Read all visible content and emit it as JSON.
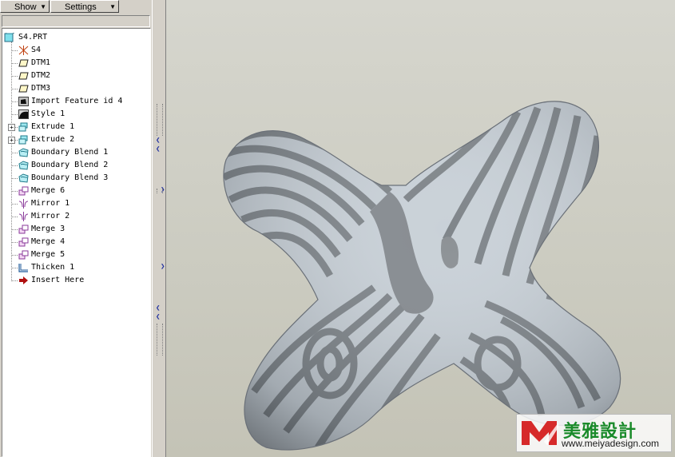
{
  "toolbar": {
    "show_label": "Show",
    "settings_label": "Settings"
  },
  "tree": {
    "root": "S4.PRT",
    "items": [
      {
        "label": "S4",
        "icon": "csys-icon"
      },
      {
        "label": "DTM1",
        "icon": "datum-plane-icon"
      },
      {
        "label": "DTM2",
        "icon": "datum-plane-icon"
      },
      {
        "label": "DTM3",
        "icon": "datum-plane-icon"
      },
      {
        "label": "Import Feature id 4",
        "icon": "import-feature-icon"
      },
      {
        "label": "Style 1",
        "icon": "style-icon"
      },
      {
        "label": "Extrude 1",
        "icon": "extrude-icon",
        "expandable": true
      },
      {
        "label": "Extrude 2",
        "icon": "extrude-icon",
        "expandable": true
      },
      {
        "label": "Boundary Blend 1",
        "icon": "boundary-blend-icon"
      },
      {
        "label": "Boundary Blend 2",
        "icon": "boundary-blend-icon"
      },
      {
        "label": "Boundary Blend 3",
        "icon": "boundary-blend-icon"
      },
      {
        "label": "Merge 6",
        "icon": "merge-icon"
      },
      {
        "label": "Mirror 1",
        "icon": "mirror-icon"
      },
      {
        "label": "Mirror 2",
        "icon": "mirror-icon"
      },
      {
        "label": "Merge 3",
        "icon": "merge-icon"
      },
      {
        "label": "Merge 4",
        "icon": "merge-icon"
      },
      {
        "label": "Merge 5",
        "icon": "merge-icon"
      },
      {
        "label": "Thicken 1",
        "icon": "thicken-icon"
      },
      {
        "label": "Insert Here",
        "icon": "insert-here-arrow-icon"
      }
    ]
  },
  "watermark": {
    "name": "美雅設計",
    "url": "www.meiyadesign.com"
  },
  "colors": {
    "tree_bg": "#ffffff",
    "panel_bg": "#d4d0c8",
    "viewport_bg": "#cbcbc0",
    "model_dark": "#7e8489",
    "model_light": "#c9d1d8"
  }
}
